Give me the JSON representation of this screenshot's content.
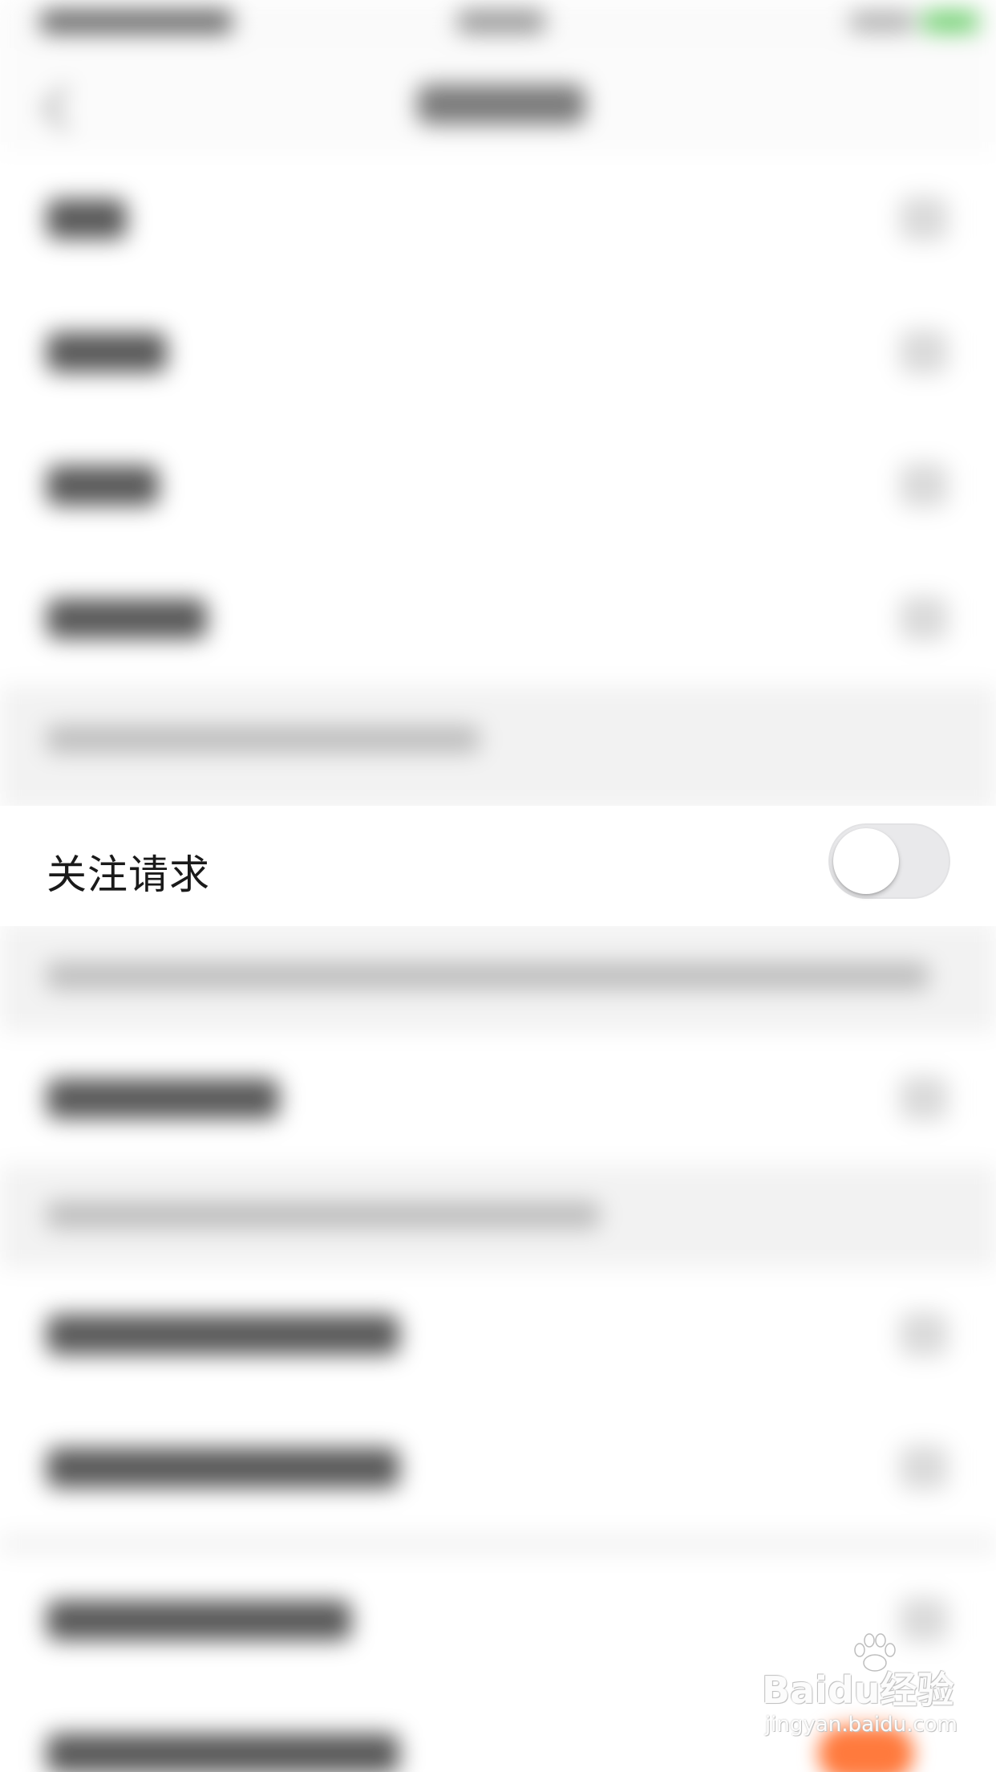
{
  "settings_row": {
    "label": "关注请求",
    "toggle_state": "off"
  },
  "watermark": {
    "logo": "Baidu经验",
    "url": "jingyan.baidu.com"
  },
  "colors": {
    "background": "#ffffff",
    "section_gap": "#f2f2f2",
    "toggle_off_track": "#e9e9eb",
    "accent_orange": "#ff7a3d"
  }
}
